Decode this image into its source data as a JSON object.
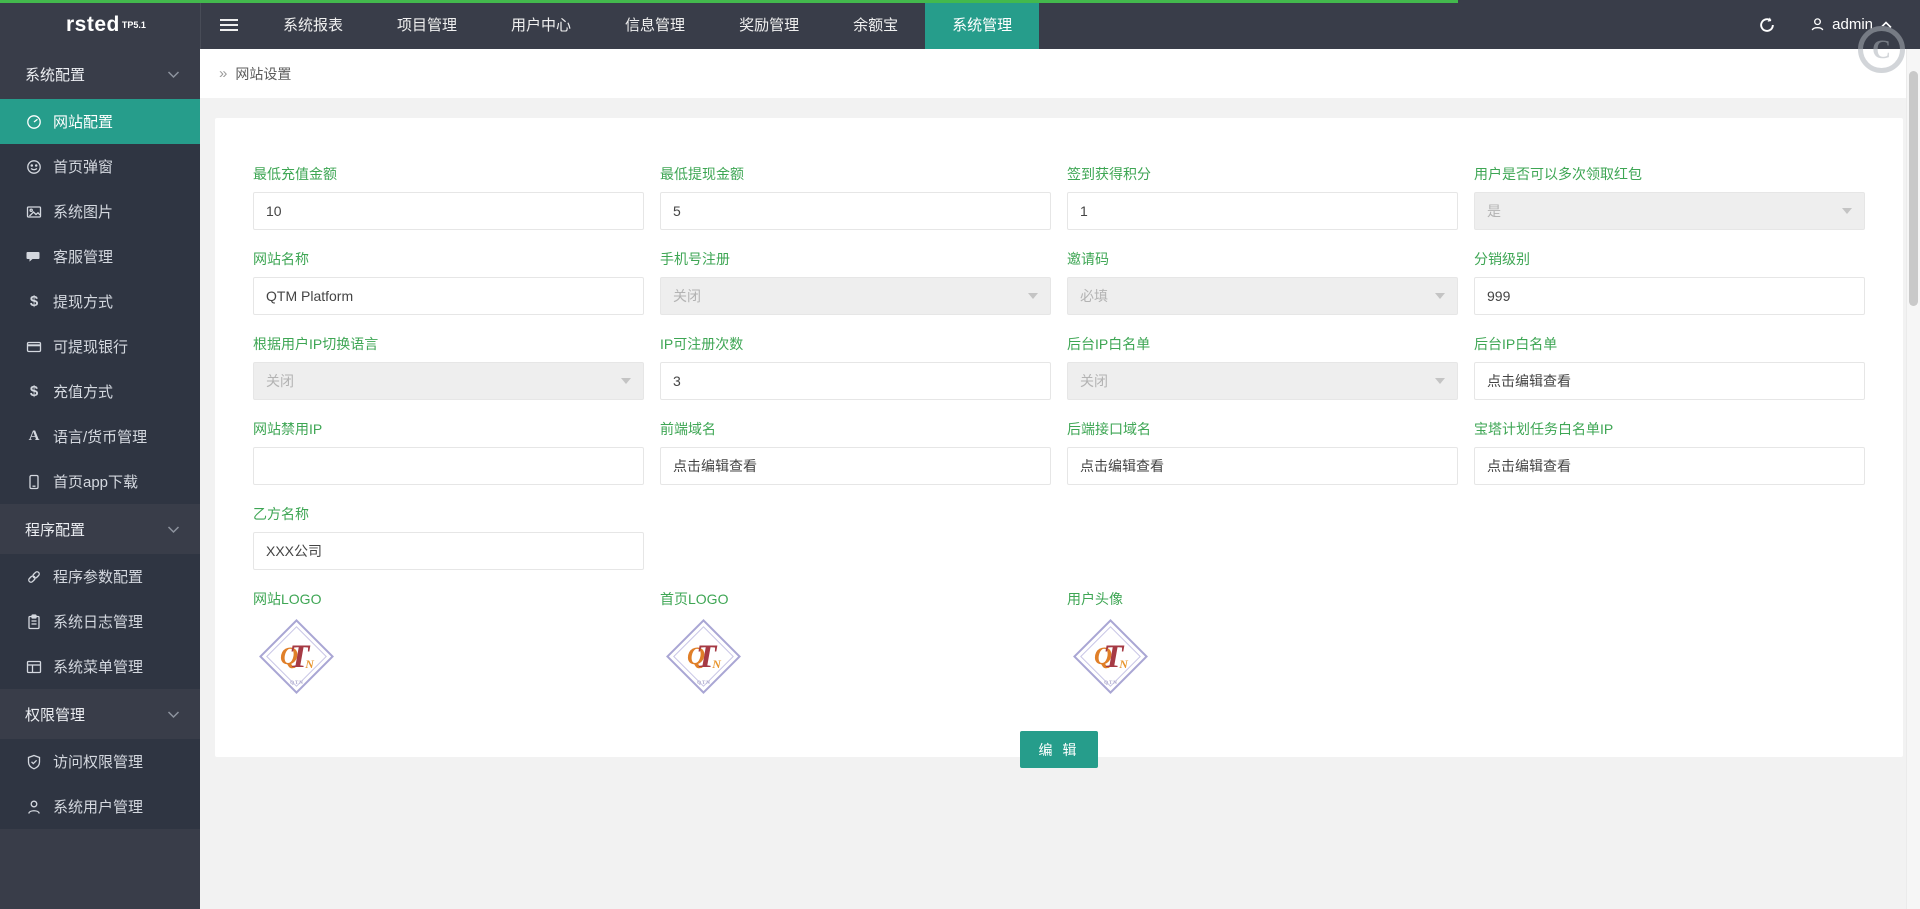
{
  "colors": {
    "accent": "#269d8b",
    "label_green": "#3ea654",
    "progress_green": "#43b94d",
    "topbar_bg": "#393d49",
    "sidebar_item_bg": "#2f3542"
  },
  "topbar": {
    "logo": "rsted",
    "logo_sup": "TP5.1",
    "tabs": [
      {
        "name": "system-reports",
        "label": "系统报表",
        "active": false
      },
      {
        "name": "project-management",
        "label": "项目管理",
        "active": false
      },
      {
        "name": "user-center",
        "label": "用户中心",
        "active": false
      },
      {
        "name": "info-management",
        "label": "信息管理",
        "active": false
      },
      {
        "name": "reward-management",
        "label": "奖励管理",
        "active": false
      },
      {
        "name": "yuebao",
        "label": "余额宝",
        "active": false
      },
      {
        "name": "system-management",
        "label": "系统管理",
        "active": true
      }
    ],
    "username": "admin"
  },
  "sidebar": {
    "groups": [
      {
        "name": "system-config",
        "label": "系统配置",
        "items": [
          {
            "name": "website-config",
            "label": "网站配置",
            "icon": "gauge",
            "active": true
          },
          {
            "name": "home-popup",
            "label": "首页弹窗",
            "icon": "smiley",
            "active": false
          },
          {
            "name": "system-images",
            "label": "系统图片",
            "icon": "image",
            "active": false
          },
          {
            "name": "customer-service",
            "label": "客服管理",
            "icon": "chat",
            "active": false
          },
          {
            "name": "withdraw-methods",
            "label": "提现方式",
            "icon": "dollar",
            "active": false
          },
          {
            "name": "withdraw-banks",
            "label": "可提现银行",
            "icon": "card",
            "active": false
          },
          {
            "name": "recharge-methods",
            "label": "充值方式",
            "icon": "dollar",
            "active": false
          },
          {
            "name": "language-currency",
            "label": "语言/货币管理",
            "icon": "letterA",
            "active": false
          },
          {
            "name": "home-app-download",
            "label": "首页app下载",
            "icon": "phone",
            "active": false
          }
        ]
      },
      {
        "name": "program-config",
        "label": "程序配置",
        "items": [
          {
            "name": "program-params-config",
            "label": "程序参数配置",
            "icon": "link",
            "active": false
          },
          {
            "name": "system-log-management",
            "label": "系统日志管理",
            "icon": "clipboard",
            "active": false
          },
          {
            "name": "system-menu-management",
            "label": "系统菜单管理",
            "icon": "layout",
            "active": false
          }
        ]
      },
      {
        "name": "permission-management",
        "label": "权限管理",
        "items": [
          {
            "name": "access-permission",
            "label": "访问权限管理",
            "icon": "shield",
            "active": false
          },
          {
            "name": "system-user-management",
            "label": "系统用户管理",
            "icon": "person",
            "active": false
          }
        ]
      }
    ]
  },
  "breadcrumb": {
    "separator": "»",
    "label": "网站设置"
  },
  "form": {
    "rows": [
      {
        "fields": [
          {
            "name": "min-recharge-amount",
            "label": "最低充值金额",
            "value": "10",
            "type": "input"
          },
          {
            "name": "min-withdraw-amount",
            "label": "最低提现金额",
            "value": "5",
            "type": "input"
          },
          {
            "name": "signin-points",
            "label": "签到获得积分",
            "value": "1",
            "type": "input"
          },
          {
            "name": "multi-redpacket",
            "label": "用户是否可以多次领取红包",
            "value": "是",
            "type": "select"
          }
        ]
      },
      {
        "fields": [
          {
            "name": "site-name",
            "label": "网站名称",
            "value": "QTM Platform",
            "type": "input"
          },
          {
            "name": "phone-register",
            "label": "手机号注册",
            "value": "关闭",
            "type": "select"
          },
          {
            "name": "invite-code",
            "label": "邀请码",
            "value": "必填",
            "type": "select"
          },
          {
            "name": "distribution-level",
            "label": "分销级别",
            "value": "999",
            "type": "input"
          }
        ]
      },
      {
        "fields": [
          {
            "name": "ip-language-switch",
            "label": "根据用户IP切换语言",
            "value": "关闭",
            "type": "select"
          },
          {
            "name": "ip-register-count",
            "label": "IP可注册次数",
            "value": "3",
            "type": "input"
          },
          {
            "name": "admin-ip-whitelist-switch",
            "label": "后台IP白名单",
            "value": "关闭",
            "type": "select"
          },
          {
            "name": "admin-ip-whitelist",
            "label": "后台IP白名单",
            "value": "点击编辑查看",
            "type": "input"
          }
        ]
      },
      {
        "fields": [
          {
            "name": "site-banned-ip",
            "label": "网站禁用IP",
            "value": "",
            "type": "input"
          },
          {
            "name": "frontend-domain",
            "label": "前端域名",
            "value": "点击编辑查看",
            "type": "input"
          },
          {
            "name": "backend-api-domain",
            "label": "后端接口域名",
            "value": "点击编辑查看",
            "type": "input"
          },
          {
            "name": "bt-task-whitelist-ip",
            "label": "宝塔计划任务白名单IP",
            "value": "点击编辑查看",
            "type": "input"
          }
        ]
      },
      {
        "fields": [
          {
            "name": "party-b-name",
            "label": "乙方名称",
            "value": "XXX公司",
            "type": "input"
          }
        ]
      }
    ],
    "logos": [
      {
        "name": "site-logo",
        "label": "网站LOGO",
        "monogram": "QTN"
      },
      {
        "name": "home-logo",
        "label": "首页LOGO",
        "monogram": "QTN"
      },
      {
        "name": "user-avatar",
        "label": "用户头像",
        "monogram": "QTN"
      }
    ],
    "submit_label": "编 辑"
  }
}
